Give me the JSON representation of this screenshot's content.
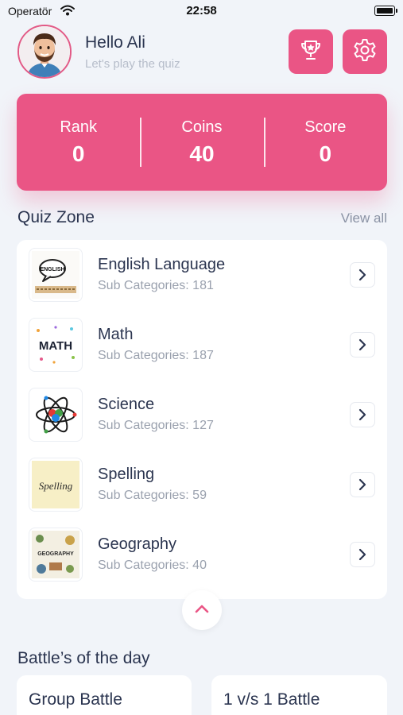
{
  "status_bar": {
    "carrier": "Operatör",
    "time": "22:58"
  },
  "header": {
    "greeting": "Hello Ali",
    "subtitle": "Let's play the quiz"
  },
  "stats": [
    {
      "label": "Rank",
      "value": "0"
    },
    {
      "label": "Coins",
      "value": "40"
    },
    {
      "label": "Score",
      "value": "0"
    }
  ],
  "quiz_zone": {
    "title": "Quiz Zone",
    "view_all": "View all",
    "items": [
      {
        "title": "English Language",
        "subtitle": "Sub Categories: 181",
        "thumb_text": "ENGLISH"
      },
      {
        "title": "Math",
        "subtitle": "Sub Categories: 187",
        "thumb_text": "MATH"
      },
      {
        "title": "Science",
        "subtitle": "Sub Categories: 127",
        "thumb_text": ""
      },
      {
        "title": "Spelling",
        "subtitle": "Sub Categories: 59",
        "thumb_text": "Spelling"
      },
      {
        "title": "Geography",
        "subtitle": "Sub Categories: 40",
        "thumb_text": "GEOGRAPHY"
      }
    ]
  },
  "battles": {
    "title": "Battle’s of the day",
    "cards": [
      {
        "label": "Group Battle"
      },
      {
        "label": "1 v/s 1 Battle"
      }
    ]
  },
  "colors": {
    "accent": "#ea5585",
    "background": "#f1f4f9",
    "text": "#2b3550",
    "muted": "#9aa1ae"
  },
  "icons": [
    "wifi-icon",
    "battery-icon",
    "trophy-icon",
    "gear-icon",
    "chevron-right-icon",
    "chevron-up-icon"
  ]
}
